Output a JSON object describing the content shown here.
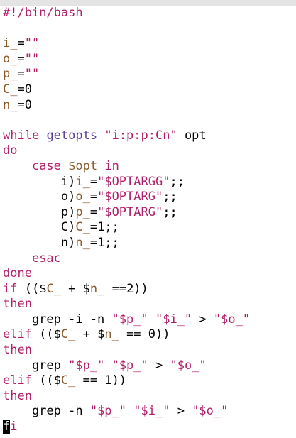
{
  "editor": {
    "colors": {
      "keyword": "#b0206a",
      "command": "#5b3b9a",
      "variable": "#8a5a2b",
      "string": "#b0206a",
      "text": "#000000",
      "background": "#ffffff"
    },
    "lines": [
      [
        {
          "t": "#!/bin/bash",
          "c": "kw"
        }
      ],
      [],
      [
        {
          "t": "i_",
          "c": "var"
        },
        {
          "t": "=",
          "c": ""
        },
        {
          "t": "\"\"",
          "c": "str"
        }
      ],
      [
        {
          "t": "o_",
          "c": "var"
        },
        {
          "t": "=",
          "c": ""
        },
        {
          "t": "\"\"",
          "c": "str"
        }
      ],
      [
        {
          "t": "p_",
          "c": "var"
        },
        {
          "t": "=",
          "c": ""
        },
        {
          "t": "\"\"",
          "c": "str"
        }
      ],
      [
        {
          "t": "C_",
          "c": "var"
        },
        {
          "t": "=0",
          "c": ""
        }
      ],
      [
        {
          "t": "n_",
          "c": "var"
        },
        {
          "t": "=0",
          "c": ""
        }
      ],
      [],
      [
        {
          "t": "while",
          "c": "kw"
        },
        {
          "t": " ",
          "c": ""
        },
        {
          "t": "getopts",
          "c": "cmd"
        },
        {
          "t": " ",
          "c": ""
        },
        {
          "t": "\"i:p:p:Cn\"",
          "c": "str"
        },
        {
          "t": " opt",
          "c": ""
        }
      ],
      [
        {
          "t": "do",
          "c": "kw"
        }
      ],
      [
        {
          "t": "    ",
          "c": ""
        },
        {
          "t": "case",
          "c": "kw"
        },
        {
          "t": " ",
          "c": ""
        },
        {
          "t": "$opt",
          "c": "var"
        },
        {
          "t": " ",
          "c": ""
        },
        {
          "t": "in",
          "c": "kw"
        }
      ],
      [
        {
          "t": "        i)",
          "c": ""
        },
        {
          "t": "i_",
          "c": "var"
        },
        {
          "t": "=",
          "c": ""
        },
        {
          "t": "\"$OPTARGG\"",
          "c": "str"
        },
        {
          "t": ";;",
          "c": ""
        }
      ],
      [
        {
          "t": "        o)",
          "c": ""
        },
        {
          "t": "o_",
          "c": "var"
        },
        {
          "t": "=",
          "c": ""
        },
        {
          "t": "\"$OPTARG\"",
          "c": "str"
        },
        {
          "t": ";;",
          "c": ""
        }
      ],
      [
        {
          "t": "        p)",
          "c": ""
        },
        {
          "t": "p_",
          "c": "var"
        },
        {
          "t": "=",
          "c": ""
        },
        {
          "t": "\"$OPTARG\"",
          "c": "str"
        },
        {
          "t": ";;",
          "c": ""
        }
      ],
      [
        {
          "t": "        C)",
          "c": ""
        },
        {
          "t": "C_",
          "c": "var"
        },
        {
          "t": "=1;;",
          "c": ""
        }
      ],
      [
        {
          "t": "        n)",
          "c": ""
        },
        {
          "t": "n_",
          "c": "var"
        },
        {
          "t": "=1;;",
          "c": ""
        }
      ],
      [
        {
          "t": "    ",
          "c": ""
        },
        {
          "t": "esac",
          "c": "kw"
        }
      ],
      [
        {
          "t": "done",
          "c": "kw"
        }
      ],
      [
        {
          "t": "if",
          "c": "kw"
        },
        {
          "t": " (($",
          "c": ""
        },
        {
          "t": "C_",
          "c": "var"
        },
        {
          "t": " + $",
          "c": ""
        },
        {
          "t": "n_",
          "c": "var"
        },
        {
          "t": " ==2))",
          "c": ""
        }
      ],
      [
        {
          "t": "then",
          "c": "kw"
        }
      ],
      [
        {
          "t": "    grep -i -n ",
          "c": ""
        },
        {
          "t": "\"$p_\"",
          "c": "str"
        },
        {
          "t": " ",
          "c": ""
        },
        {
          "t": "\"$i_\"",
          "c": "str"
        },
        {
          "t": " > ",
          "c": ""
        },
        {
          "t": "\"$o_\"",
          "c": "str"
        }
      ],
      [
        {
          "t": "elif",
          "c": "kw"
        },
        {
          "t": " (($",
          "c": ""
        },
        {
          "t": "C_",
          "c": "var"
        },
        {
          "t": " + $",
          "c": ""
        },
        {
          "t": "n_",
          "c": "var"
        },
        {
          "t": " == 0))",
          "c": ""
        }
      ],
      [
        {
          "t": "then",
          "c": "kw"
        }
      ],
      [
        {
          "t": "    grep ",
          "c": ""
        },
        {
          "t": "\"$p_\"",
          "c": "str"
        },
        {
          "t": " ",
          "c": ""
        },
        {
          "t": "\"$p_\"",
          "c": "str"
        },
        {
          "t": " > ",
          "c": ""
        },
        {
          "t": "\"$o_\"",
          "c": "str"
        }
      ],
      [
        {
          "t": "elif",
          "c": "kw"
        },
        {
          "t": " (($",
          "c": ""
        },
        {
          "t": "C_",
          "c": "var"
        },
        {
          "t": " == 1))",
          "c": ""
        }
      ],
      [
        {
          "t": "then",
          "c": "kw"
        }
      ],
      [
        {
          "t": "    grep -n ",
          "c": ""
        },
        {
          "t": "\"$p_\"",
          "c": "str"
        },
        {
          "t": " ",
          "c": ""
        },
        {
          "t": "\"$i_\"",
          "c": "str"
        },
        {
          "t": " > ",
          "c": ""
        },
        {
          "t": "\"$o_\"",
          "c": "str"
        }
      ],
      [
        {
          "t": "f",
          "c": "cursor"
        },
        {
          "t": "i",
          "c": "kw"
        }
      ]
    ]
  }
}
